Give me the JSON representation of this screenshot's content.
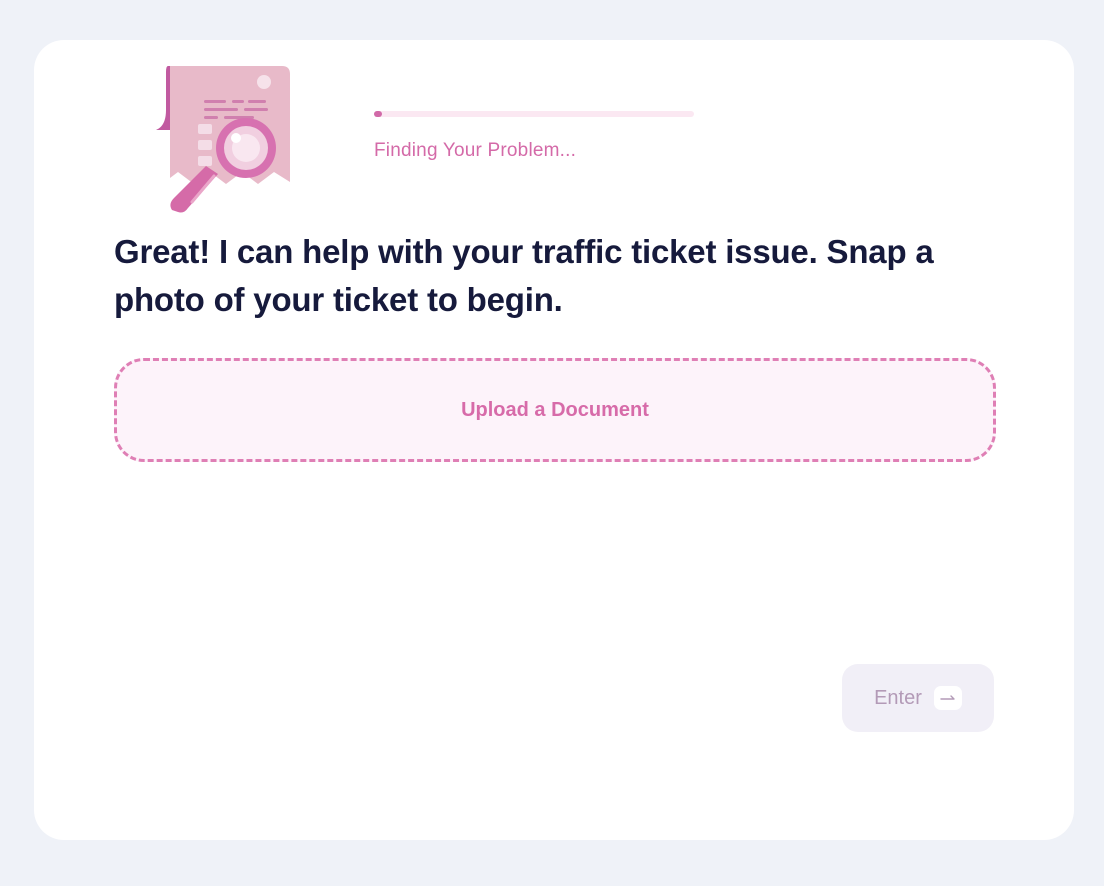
{
  "progress": {
    "label": "Finding Your Problem...",
    "fraction": 0.02
  },
  "question": {
    "text": "Great! I can help with your traffic ticket issue. Snap a photo of your ticket to begin."
  },
  "upload": {
    "label": "Upload a Document"
  },
  "enter": {
    "label": "Enter",
    "icon": "arrow-right-icon"
  },
  "colors": {
    "background": "#eff2f8",
    "accent": "#d46aa8",
    "heading": "#161a3c",
    "upload_fill": "#fdf3fa",
    "enter_fill": "#f1eff7"
  }
}
